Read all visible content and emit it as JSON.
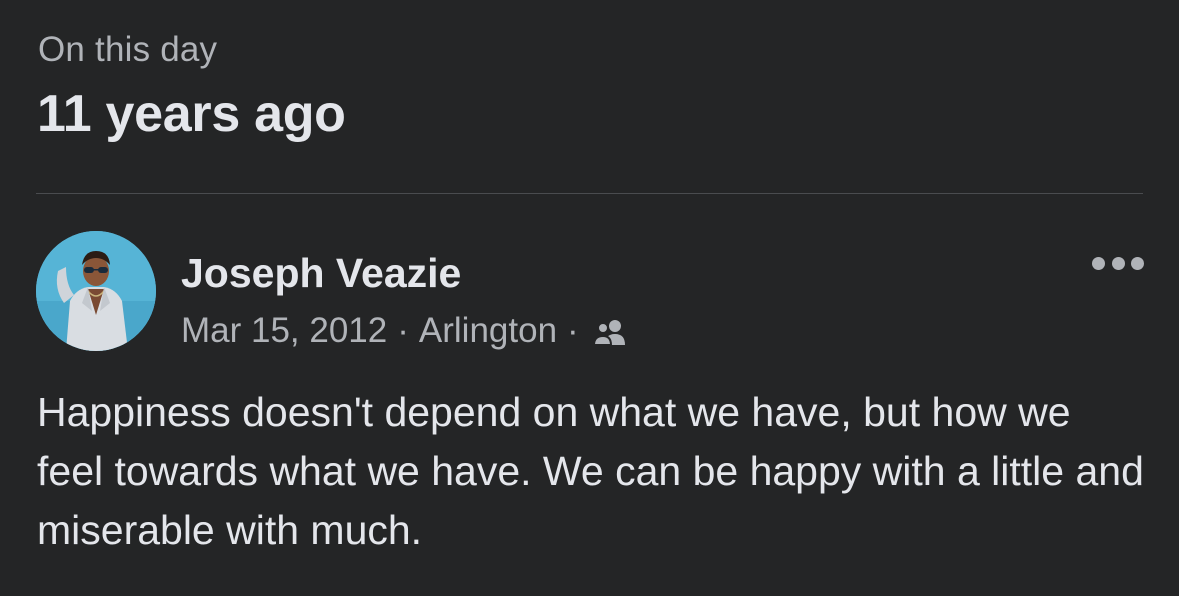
{
  "memory": {
    "label": "On this day",
    "time_ago": "11 years ago"
  },
  "post": {
    "author": "Joseph Veazie",
    "date": "Mar 15, 2012",
    "separator": "·",
    "location": "Arlington",
    "audience_icon": "friends-icon",
    "text": "Happiness doesn't depend on what we have, but how we feel towards what we have. We can be happy with a little and miserable with much."
  },
  "colors": {
    "background": "#242526",
    "primary_text": "#e4e6eb",
    "secondary_text": "#b0b3b8",
    "divider": "#4a4c4f"
  }
}
